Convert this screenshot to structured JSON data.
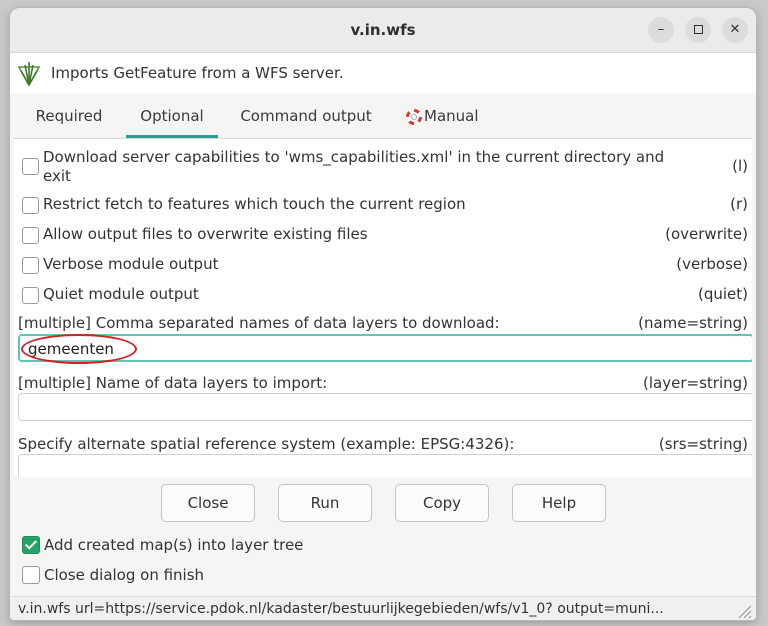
{
  "window": {
    "title": "v.in.wfs"
  },
  "header": {
    "description": "Imports GetFeature from a WFS server."
  },
  "tabs": [
    {
      "label": "Required"
    },
    {
      "label": "Optional"
    },
    {
      "label": "Command output"
    },
    {
      "label": "Manual"
    }
  ],
  "flags": [
    {
      "text_line1": "Download server capabilities to 'wms_capabilities.xml' in the current directory and",
      "text_line2": "exit",
      "key": "(l)"
    },
    {
      "text": "Restrict fetch to features which touch the current region",
      "key": "(r)"
    },
    {
      "text": "Allow output files to overwrite existing files",
      "key": "(overwrite)"
    },
    {
      "text": "Verbose module output",
      "key": "(verbose)"
    },
    {
      "text": "Quiet module output",
      "key": "(quiet)"
    }
  ],
  "fields": [
    {
      "label": "[multiple] Comma separated names of data layers to download:",
      "key": "(name=string)",
      "value": "gemeenten"
    },
    {
      "label": "[multiple] Name of data layers to import:",
      "key": "(layer=string)",
      "value": ""
    },
    {
      "label": "Specify alternate spatial reference system (example: EPSG:4326):",
      "key": "(srs=string)",
      "value": ""
    }
  ],
  "buttons": {
    "close": "Close",
    "run": "Run",
    "copy": "Copy",
    "help": "Help"
  },
  "options": [
    {
      "label": "Add created map(s) into layer tree",
      "checked": true
    },
    {
      "label": "Close dialog on finish",
      "checked": false
    }
  ],
  "status": {
    "command": "v.in.wfs url=https://service.pdok.nl/kadaster/bestuurlijkegebieden/wfs/v1_0? output=muni..."
  },
  "colors": {
    "accent": "#2a9d8f",
    "focus_border": "#5fc6b6",
    "checkbox_checked": "#26a269",
    "annotation": "#d42020"
  }
}
